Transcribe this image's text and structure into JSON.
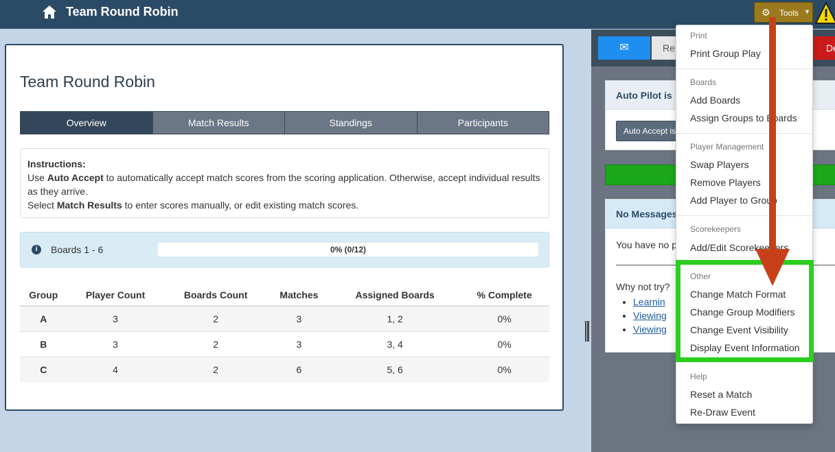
{
  "navbar": {
    "title": "Team Round Robin",
    "tools_label": "Tools"
  },
  "main": {
    "title": "Team Round Robin",
    "tabs": [
      {
        "label": "Overview",
        "active": true
      },
      {
        "label": "Match Results",
        "active": false
      },
      {
        "label": "Standings",
        "active": false
      },
      {
        "label": "Participants",
        "active": false
      }
    ],
    "instructions": {
      "heading": "Instructions:",
      "line1_pre": "Use ",
      "line1_bold": "Auto Accept",
      "line1_post": " to automatically accept match scores from the scoring application. Otherwise, accept individual results as they arrive.",
      "line2_pre": "Select ",
      "line2_bold": "Match Results",
      "line2_post": " to enter scores manually, or edit existing match scores."
    },
    "boards": {
      "label": "Boards 1 - 6",
      "progress_text": "0% (0/12)",
      "progress_fraction": 0.0
    },
    "table": {
      "headers": [
        "Group",
        "Player Count",
        "Boards Count",
        "Matches",
        "Assigned Boards",
        "% Complete"
      ],
      "rows": [
        [
          "A",
          "3",
          "2",
          "3",
          "1, 2",
          "0%"
        ],
        [
          "B",
          "3",
          "2",
          "3",
          "3, 4",
          "0%"
        ],
        [
          "C",
          "4",
          "2",
          "6",
          "5, 6",
          "0%"
        ]
      ]
    }
  },
  "right_panel": {
    "res_label": "Re",
    "del_label": "De",
    "autopilot_title": "Auto Pilot is",
    "autoaccept_label": "Auto Accept is",
    "messages_title": "No Messages",
    "messages_text": "You have no p",
    "why_text": "Why not try?",
    "links": [
      "Learnin",
      "Viewing",
      "Viewing"
    ]
  },
  "dropdown": {
    "sections": [
      {
        "header": "Print",
        "items": [
          "Print Group Play"
        ]
      },
      {
        "header": "Boards",
        "items": [
          "Add Boards",
          "Assign Groups to Boards"
        ]
      },
      {
        "header": "Player Management",
        "items": [
          "Swap Players",
          "Remove Players",
          "Add Player to Group"
        ]
      },
      {
        "header": "Scorekeepers",
        "items": [
          "Add/Edit Scorekeepers"
        ]
      },
      {
        "header": "Other",
        "items": [
          "Change Match Format",
          "Change Group Modifiers",
          "Change Event Visibility",
          "Display Event Information"
        ]
      },
      {
        "header": "Help",
        "items": [
          "Reset a Match",
          "Re-Draw Event"
        ]
      }
    ]
  },
  "colors": {
    "navbar": "#2b4a66",
    "tools_button": "#9a7a1c",
    "highlight": "#2bcf1f",
    "arrow": "#c8401a"
  }
}
